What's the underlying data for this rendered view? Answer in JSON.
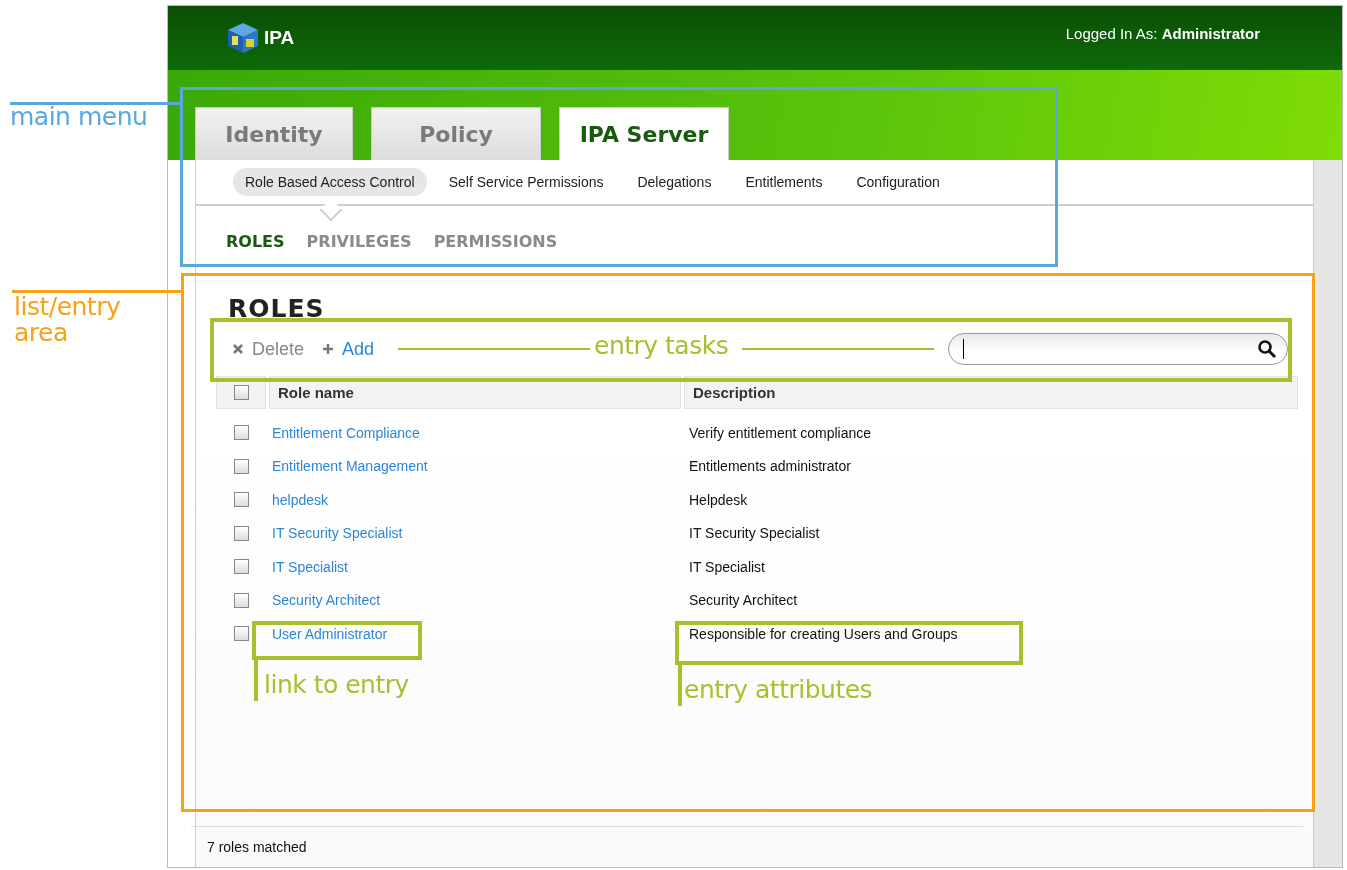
{
  "header": {
    "logo": "IPA",
    "login_label": "Logged In As:",
    "user": "Administrator"
  },
  "tabs": [
    {
      "label": "Identity",
      "selected": false
    },
    {
      "label": "Policy",
      "selected": false
    },
    {
      "label": "IPA Server",
      "selected": true
    }
  ],
  "sub_tabs": [
    {
      "label": "Role Based Access Control",
      "selected": true
    },
    {
      "label": "Self Service Permissions",
      "selected": false
    },
    {
      "label": "Delegations",
      "selected": false
    },
    {
      "label": "Entitlements",
      "selected": false
    },
    {
      "label": "Configuration",
      "selected": false
    }
  ],
  "section_tabs": [
    {
      "label": "ROLES",
      "selected": true
    },
    {
      "label": "PRIVILEGES",
      "selected": false
    },
    {
      "label": "PERMISSIONS",
      "selected": false
    }
  ],
  "page_title": "ROLES",
  "actions": [
    {
      "label": "Delete",
      "kind": "delete",
      "disabled": true
    },
    {
      "label": "Add",
      "kind": "add",
      "disabled": false
    }
  ],
  "table": {
    "select_all_checked": false,
    "columns": [
      "Role name",
      "Description"
    ],
    "rows": [
      {
        "role_name": "Entitlement Compliance",
        "description": "Verify entitlement compliance",
        "checked": false
      },
      {
        "role_name": "Entitlement Management",
        "description": "Entitlements administrator",
        "checked": false
      },
      {
        "role_name": "helpdesk",
        "description": "Helpdesk",
        "checked": false
      },
      {
        "role_name": "IT Security Specialist",
        "description": "IT Security Specialist",
        "checked": false
      },
      {
        "role_name": "IT Specialist",
        "description": "IT Specialist",
        "checked": false
      },
      {
        "role_name": "Security Architect",
        "description": "Security Architect",
        "checked": false
      },
      {
        "role_name": "User Administrator",
        "description": "Responsible for creating Users and Groups",
        "checked": false
      }
    ]
  },
  "status_bar": "7 roles matched",
  "annotations": [
    {
      "label": "main menu",
      "color": "#5aa7e0"
    },
    {
      "label": "list/entry area",
      "color": "#f7a116"
    },
    {
      "label": "entry tasks",
      "color": "#a8c030"
    },
    {
      "label": "link to entry",
      "color": "#a8c030"
    },
    {
      "label": "entry attributes",
      "color": "#a8c030"
    }
  ]
}
